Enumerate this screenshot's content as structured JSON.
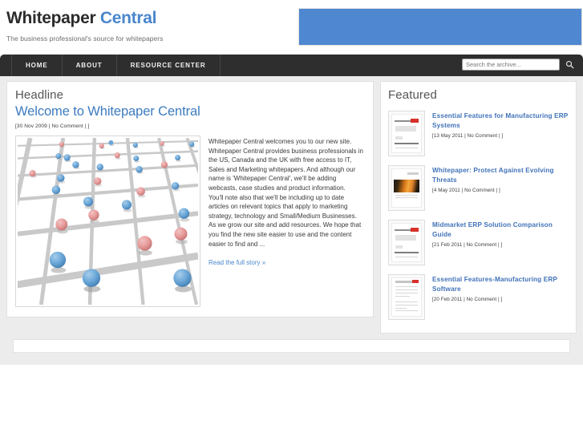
{
  "header": {
    "brand_primary": "Whitepaper",
    "brand_accent": "Central",
    "tagline": "The business professional's source for whitepapers",
    "banner_color": "#4f87d0"
  },
  "nav": {
    "items": [
      {
        "label": "HOME",
        "name": "nav-item-home"
      },
      {
        "label": "ABOUT",
        "name": "nav-item-about"
      },
      {
        "label": "RESOURCE CENTER",
        "name": "nav-item-resource-center"
      }
    ]
  },
  "search": {
    "placeholder": "Search the archive...",
    "value": "",
    "icon": "search-icon"
  },
  "main": {
    "section_title": "Headline",
    "article_title": "Welcome to Whitepaper Central",
    "article_meta": "[30 Nov 2009 | No Comment | ]",
    "paragraphs": [
      "Whitepaper Central welcomes you to our new site. Whitepaper Central provides business professionals in the US, Canada and the UK with free access to IT, Sales and Marketing whitepapers.  And although our name is 'Whitepaper Central', we'll be adding  webcasts, case studies and product information.",
      "You'll note also that we'll be including up to date articles on relevant topics that apply to marketing strategy, technology and Small/Medium Businesses.",
      "As we grow our site and add resources. We hope that you find the new site easier to use and the content easier to find and ..."
    ],
    "read_more": "Read the full story »",
    "figure_alt": "network-grid-illustration"
  },
  "sidebar": {
    "section_title": "Featured",
    "items": [
      {
        "title": "Essential Features for Manufacturing ERP Systems",
        "meta": "[13 May 2011 | No Comment | ]",
        "thumb": "document-report"
      },
      {
        "title": "Whitepaper: Protect Against Evolving Threats",
        "meta": "[4 May 2011 | No Comment | ]",
        "thumb": "document-photo"
      },
      {
        "title": "Midmarket ERP Solution Comparison Guide",
        "meta": "[21 Feb 2011 | No Comment | ]",
        "thumb": "document-report"
      },
      {
        "title": "Essential Features-Manufacturing ERP Software",
        "meta": "[20 Feb 2011 | No Comment | ]",
        "thumb": "document-text"
      }
    ]
  },
  "colors": {
    "accent_blue": "#4a86cc",
    "link_blue": "#4072b8",
    "nav_dark": "#2e2e2e",
    "page_gray": "#ececec"
  }
}
